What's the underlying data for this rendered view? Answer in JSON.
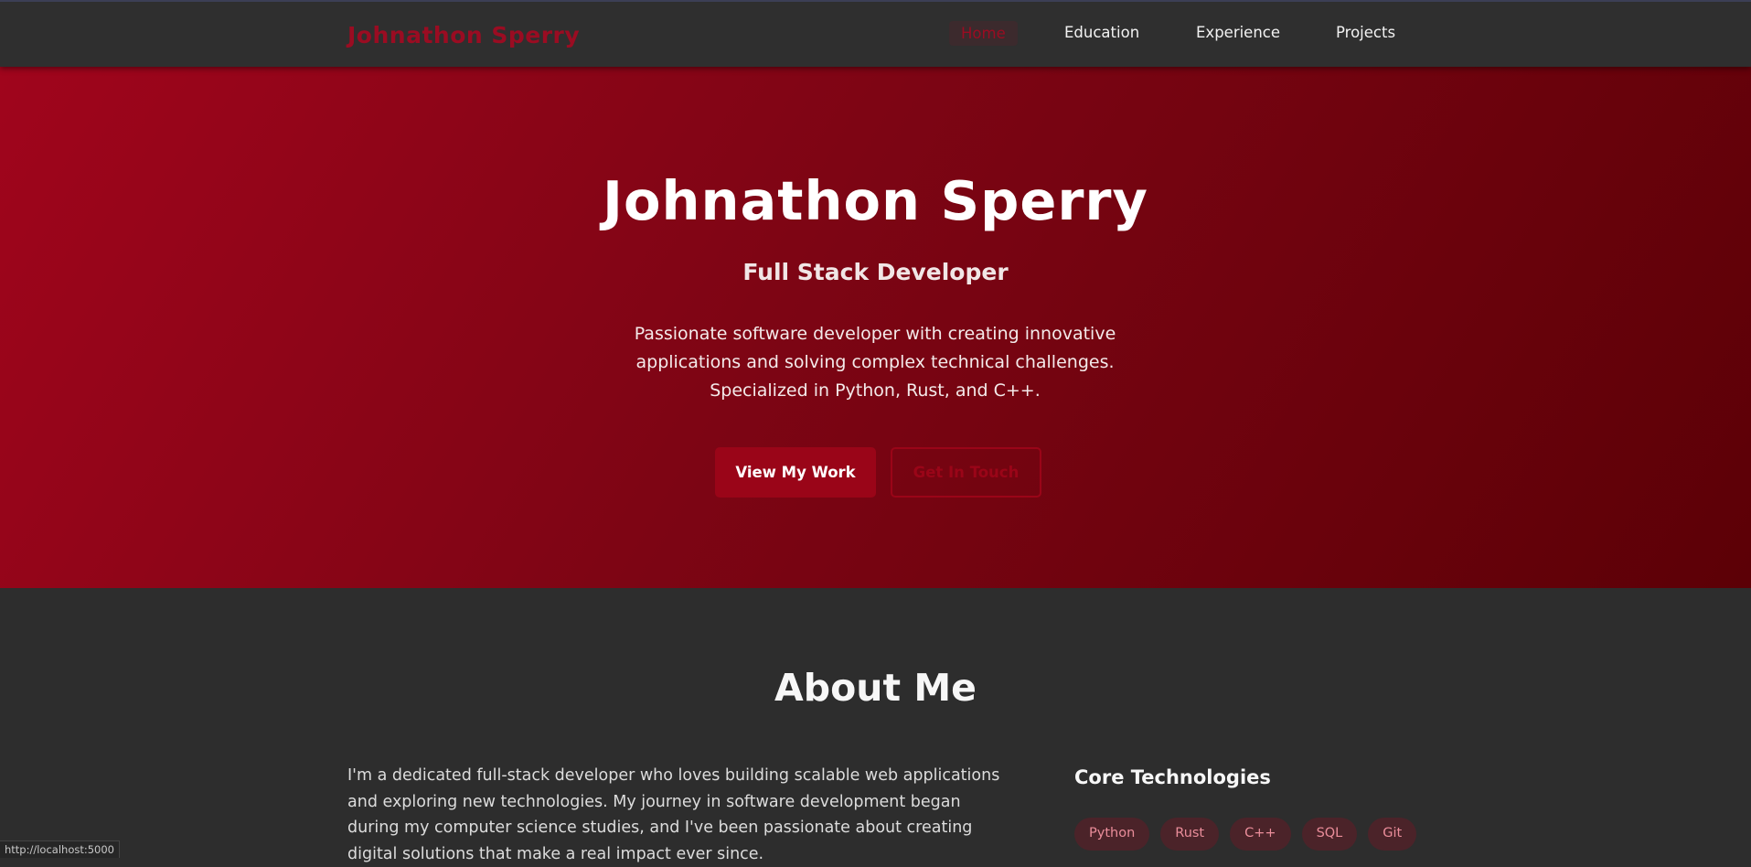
{
  "nav": {
    "brand": "Johnathon Sperry",
    "links": [
      "Home",
      "Education",
      "Experience",
      "Projects"
    ],
    "active": "Home"
  },
  "hero": {
    "title": "Johnathon Sperry",
    "subtitle": "Full Stack Developer",
    "description": "Passionate software developer with creating innovative applications and solving complex technical challenges. Specialized in Python, Rust, and C++.",
    "primary_button": "View My Work",
    "secondary_button": "Get In Touch"
  },
  "about": {
    "title": "About Me",
    "text": "I'm a dedicated full-stack developer who loves building scalable web applications and exploring new technologies. My journey in software development began during my computer science studies, and I've been passionate about creating digital solutions that make a real impact ever since.",
    "tech_title": "Core Technologies",
    "technologies": [
      "Python",
      "Rust",
      "C++",
      "SQL",
      "Git"
    ]
  },
  "status_bar": {
    "url": "http://localhost:5000"
  },
  "colors": {
    "accent": "#9a0c22",
    "page_background": "#2d2d2d",
    "hero_gradient_start": "#a0051c",
    "hero_gradient_end": "#5c0006"
  }
}
